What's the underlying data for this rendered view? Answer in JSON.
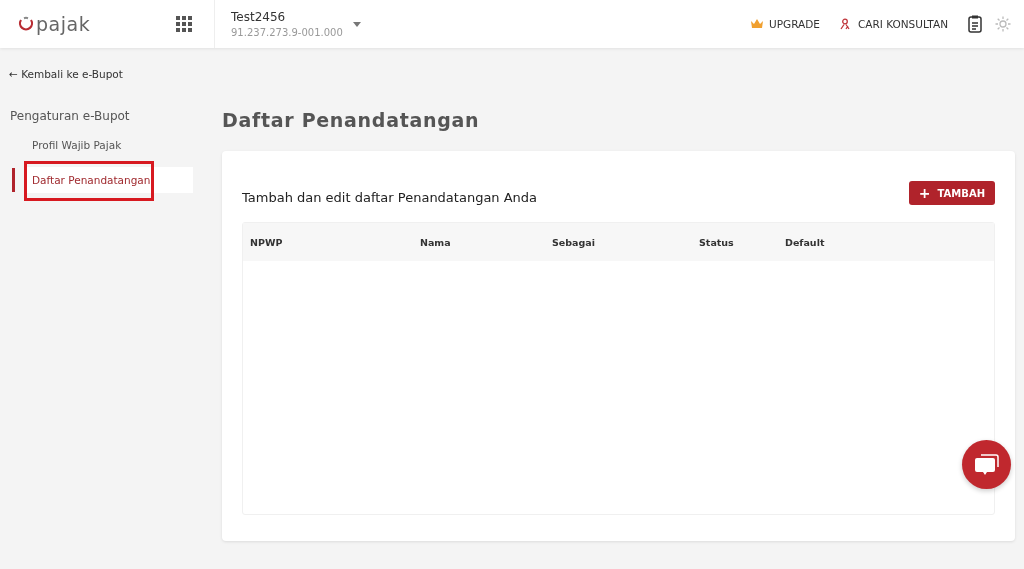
{
  "header": {
    "logo": "pajak",
    "company": {
      "name": "Test2456",
      "npwp": "91.237.273.9-001.000"
    },
    "links": [
      {
        "label": "UPGRADE",
        "kind": "crown"
      },
      {
        "label": "CARI KONSULTAN",
        "kind": "people"
      }
    ]
  },
  "sidebar": {
    "back_link": "← Kembali ke e-Bupot",
    "heading": "Pengaturan e-Bupot",
    "items": [
      {
        "label": "Profil Wajib Pajak",
        "selected": false,
        "highlighted": false
      },
      {
        "label": "Daftar Penandatangan",
        "selected": true,
        "highlighted": true
      }
    ]
  },
  "page_title": "Daftar Penandatangan",
  "card": {
    "subtitle": "Tambah dan edit daftar Penandatangan Anda",
    "add_button": "TAMBAH",
    "add_button_icon": "+",
    "table": {
      "columns": [
        "NPWP",
        "Nama",
        "Sebagai",
        "Status",
        "Default"
      ]
    }
  }
}
